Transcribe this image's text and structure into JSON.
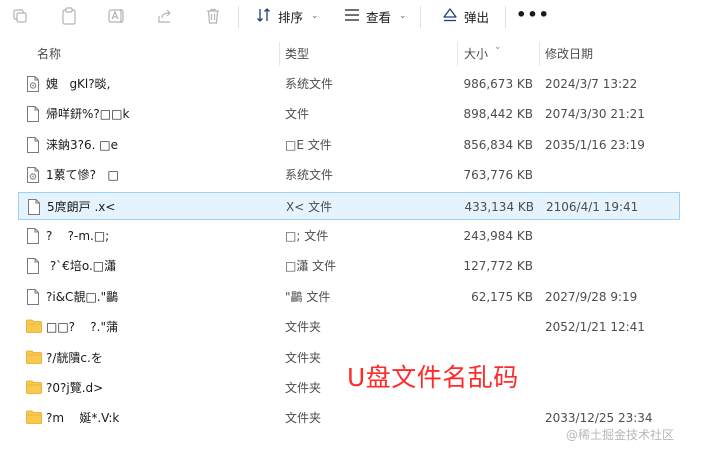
{
  "toolbar": {
    "sort_label": "排序",
    "view_label": "查看",
    "eject_label": "弹出",
    "more_label": "•••"
  },
  "columns": {
    "name": "名称",
    "type": "类型",
    "size": "大小",
    "modified": "修改日期"
  },
  "files": [
    {
      "name": "媿   gKl?晱,",
      "type": "系统文件",
      "size": "986,673 KB",
      "date": "2024/3/7 13:22",
      "icon": "system-file"
    },
    {
      "name": "帰咩鈃%?□□k",
      "type": "文件",
      "size": "898,442 KB",
      "date": "2074/3/30 21:21",
      "icon": "file"
    },
    {
      "name": "涞鈉3?6. □e",
      "type": "□E 文件",
      "size": "856,834 KB",
      "date": "2035/1/16 23:19",
      "icon": "file"
    },
    {
      "name": "1蔂て慘?   □",
      "type": "系统文件",
      "size": "763,776 KB",
      "date": "",
      "icon": "system-file"
    },
    {
      "name": "5庹朗戸 .x<",
      "type": "X< 文件",
      "size": "433,134 KB",
      "date": "2106/4/1 19:41",
      "icon": "file",
      "selected": true
    },
    {
      "name": "?    ?-m.□;",
      "type": "□; 文件",
      "size": "243,984 KB",
      "date": "",
      "icon": "file"
    },
    {
      "name": " ?`€培o.□瀟",
      "type": "□瀟 文件",
      "size": "127,772 KB",
      "date": "",
      "icon": "file"
    },
    {
      "name": "?i&C靚□.\"鸓",
      "type": "\"鸓 文件",
      "size": "62,175 KB",
      "date": "2027/9/28 9:19",
      "icon": "file"
    },
    {
      "name": "□□?    ?.\"蒲",
      "type": "文件夹",
      "size": "",
      "date": "2052/1/21 12:41",
      "icon": "folder"
    },
    {
      "name": "?/靗隤c.を",
      "type": "文件夹",
      "size": "",
      "date": "",
      "icon": "folder"
    },
    {
      "name": "?0?j覽.d>",
      "type": "文件夹",
      "size": "",
      "date": "",
      "icon": "folder"
    },
    {
      "name": "?m    娫*.V:k",
      "type": "文件夹",
      "size": "",
      "date": "2033/12/25 23:34",
      "icon": "folder"
    }
  ],
  "overlay_title": "U盘文件名乱码",
  "watermark": "@稀土掘金技术社区"
}
